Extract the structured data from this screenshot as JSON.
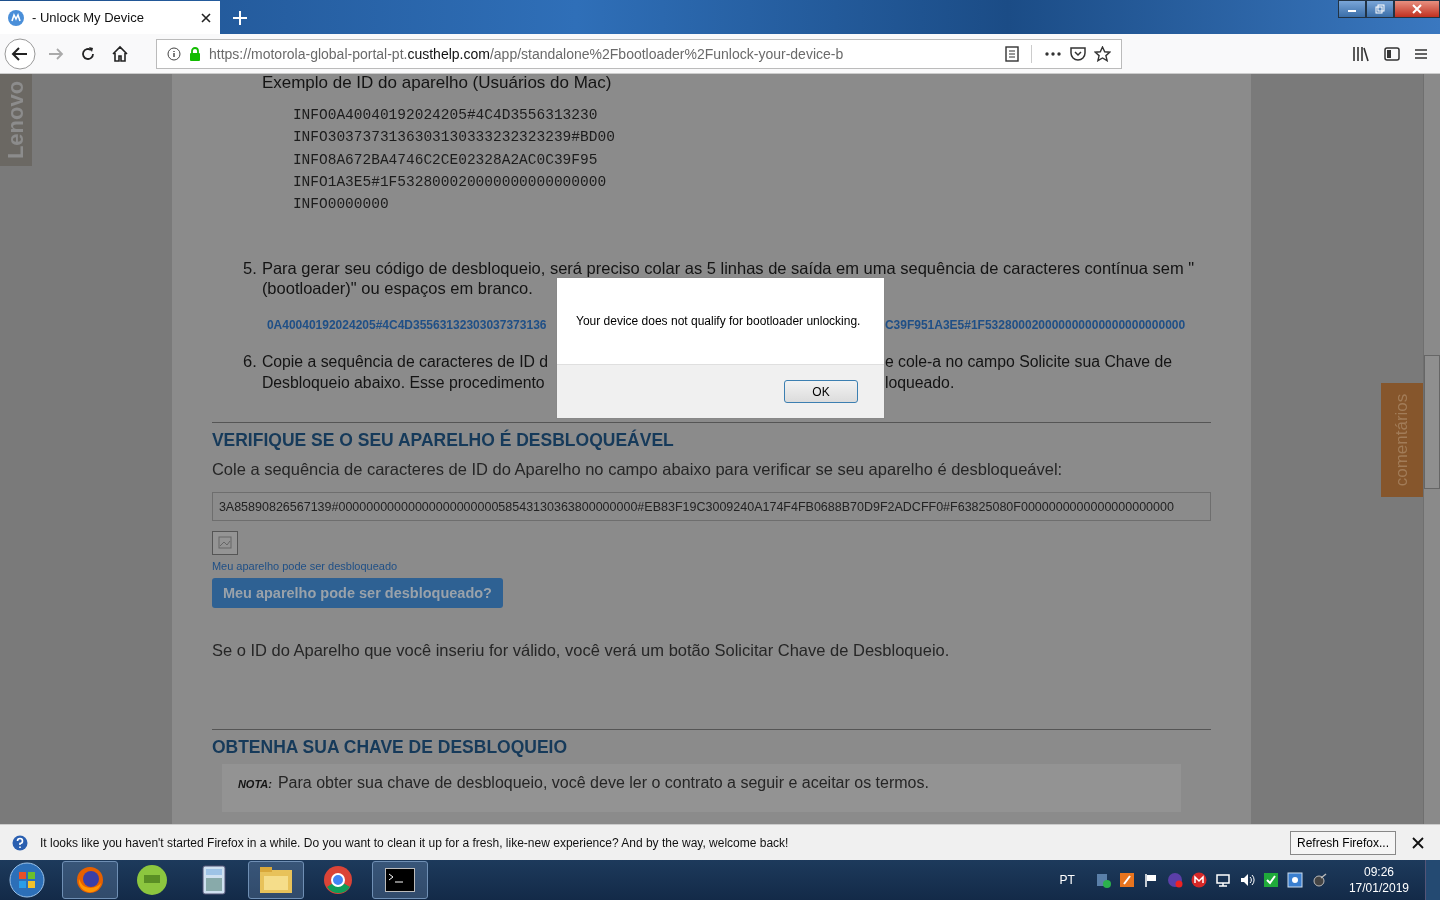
{
  "tab": {
    "title": "- Unlock My Device",
    "selected": true
  },
  "address": {
    "prefix": "https://motorola-global-portal-pt.",
    "domain": "custhelp.com",
    "path": "/app/standalone%2Fbootloader%2Funlock-your-device-b"
  },
  "side_tabs": {
    "left": "Lenovo",
    "right": "comentários"
  },
  "page": {
    "example_title": "Exemplo de ID do aparelho (Usuários do Mac)",
    "code_lines": [
      "INFO0A40040192024205#4C4D3556313230",
      "INFO3037373136303130333232323239#BD00",
      "INFO8A672BA4746C2CE02328A2AC0C39F95",
      "INFO1A3E5#1F532800020000000000000000",
      "INFO0000000"
    ],
    "step5": {
      "number": "5.",
      "text": "Para gerar seu código de desbloqueio, será preciso colar as 5 linhas de saída em uma sequência de caracteres contínua sem \"(bootloader)\" ou espaços em branco."
    },
    "joined_left": "0A40040192024205#4C4D35563132303037373136",
    "joined_right": "C39F951A3E5#1F532800020000000000000000000000",
    "step6": {
      "number": "6.",
      "left_lines": [
        "Copie a sequência de caracteres de ID d",
        "Desbloqueio abaixo. Esse procedimento"
      ],
      "right_lines": [
        "e cole-a no campo Solicite sua Chave de",
        "loqueado."
      ]
    },
    "check": {
      "heading": "VERIFIQUE SE O SEU APARELHO É DESBLOQUEÁVEL",
      "intro": "Cole a sequência de caracteres de ID do Aparelho no campo abaixo para verificar se seu aparelho é desbloqueável:",
      "value": "3A85890826567139#0000000000000000000000058543130363800000000#EB83F19C3009240A174F4FB0688B70D9F2ADCFF0#F63825080F0000000000000000000000",
      "link": "Meu aparelho pode ser desbloqueado",
      "button": "Meu aparelho pode ser desbloqueado?",
      "note": "Se o ID do Aparelho que você inseriu for válido, você verá um botão Solicitar Chave de Desbloqueio."
    },
    "key": {
      "heading": "OBTENHA SUA CHAVE DE DESBLOQUEIO",
      "nota_label": "NOTA:",
      "nota": "Para obter sua chave de desbloqueio, você deve ler o contrato a seguir e aceitar os termos."
    }
  },
  "dialog": {
    "message": "Your device does not qualify for bootloader unlocking.",
    "button": "OK"
  },
  "notification": {
    "text": "It looks like you haven't started Firefox in a while. Do you want to clean it up for a fresh, like-new experience? And by the way, welcome back!",
    "button": "Refresh Firefox..."
  },
  "taskbar": {
    "language": "PT",
    "time": "09:26",
    "date": "17/01/2019"
  }
}
